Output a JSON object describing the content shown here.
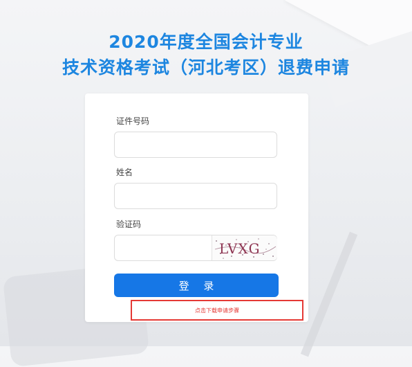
{
  "header": {
    "title_line1": "2020年度全国会计专业",
    "title_line2": "技术资格考试（河北考区）退费申请"
  },
  "form": {
    "id_label": "证件号码",
    "id_value": "",
    "name_label": "姓名",
    "name_value": "",
    "captcha_label": "验证码",
    "captcha_value": "",
    "captcha_image_text": "LVXG",
    "login_button": "登 录",
    "download_steps_link": "点击下载申请步骤"
  },
  "colors": {
    "accent": "#1d86e0",
    "button": "#1677e6",
    "link_red": "#e53935"
  }
}
